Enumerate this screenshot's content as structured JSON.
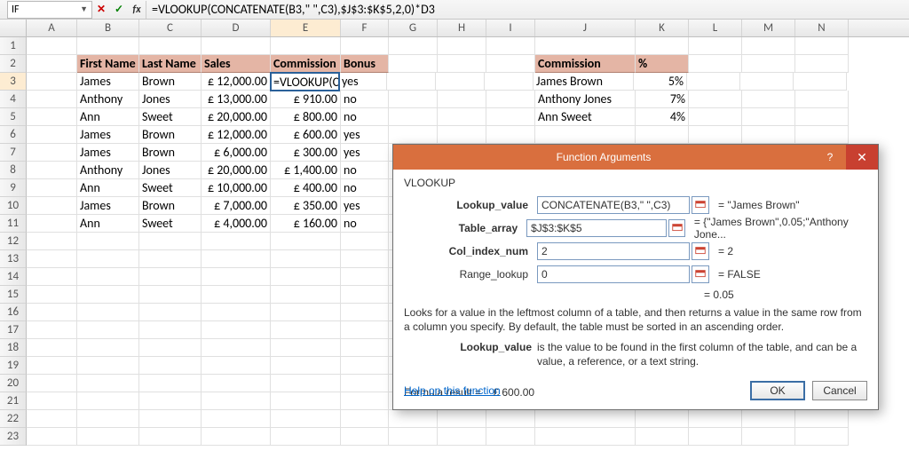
{
  "nameBox": "IF",
  "formula": "=VLOOKUP(CONCATENATE(B3,\" \",C3),$J$3:$K$5,2,0)*D3",
  "columns": [
    "A",
    "B",
    "C",
    "D",
    "E",
    "F",
    "G",
    "H",
    "I",
    "J",
    "K",
    "L",
    "M",
    "N"
  ],
  "activeCol": "E",
  "activeRow": 3,
  "editCell": "=VLOOKUP(CO",
  "headers": {
    "b": "First Name",
    "c": "Last Name",
    "d": "Sales",
    "e": "Commission",
    "f": "Bonus",
    "j": "Commission",
    "k": "%"
  },
  "table": [
    {
      "fn": "James",
      "ln": "Brown",
      "sales": "£ 12,000.00",
      "comm": "",
      "bonus": "yes"
    },
    {
      "fn": "Anthony",
      "ln": "Jones",
      "sales": "£ 13,000.00",
      "comm": "£      910.00",
      "bonus": "no"
    },
    {
      "fn": "Ann",
      "ln": "Sweet",
      "sales": "£ 20,000.00",
      "comm": "£      800.00",
      "bonus": "no"
    },
    {
      "fn": "James",
      "ln": "Brown",
      "sales": "£ 12,000.00",
      "comm": "£      600.00",
      "bonus": "yes"
    },
    {
      "fn": "James",
      "ln": "Brown",
      "sales": "£   6,000.00",
      "comm": "£      300.00",
      "bonus": "yes"
    },
    {
      "fn": "Anthony",
      "ln": "Jones",
      "sales": "£ 20,000.00",
      "comm": "£   1,400.00",
      "bonus": "no"
    },
    {
      "fn": "Ann",
      "ln": "Sweet",
      "sales": "£ 10,000.00",
      "comm": "£      400.00",
      "bonus": "no"
    },
    {
      "fn": "James",
      "ln": "Brown",
      "sales": "£   7,000.00",
      "comm": "£      350.00",
      "bonus": "yes"
    },
    {
      "fn": "Ann",
      "ln": "Sweet",
      "sales": "£   4,000.00",
      "comm": "£      160.00",
      "bonus": "no"
    }
  ],
  "lookup": [
    {
      "name": "James Brown",
      "pct": "5%"
    },
    {
      "name": "Anthony Jones",
      "pct": "7%"
    },
    {
      "name": "Ann Sweet",
      "pct": "4%"
    }
  ],
  "dialog": {
    "title": "Function Arguments",
    "fn": "VLOOKUP",
    "args": [
      {
        "label": "Lookup_value",
        "bold": true,
        "value": "CONCATENATE(B3,\" \",C3)",
        "result": "=   \"James Brown\""
      },
      {
        "label": "Table_array",
        "bold": true,
        "value": "$J$3:$K$5",
        "result": "=   {\"James Brown\",0.05;\"Anthony Jone..."
      },
      {
        "label": "Col_index_num",
        "bold": true,
        "value": "2",
        "result": "=   2"
      },
      {
        "label": "Range_lookup",
        "bold": false,
        "value": "0",
        "result": "=   FALSE"
      }
    ],
    "overallResult": "=   0.05",
    "desc": "Looks for a value in the leftmost column of a table, and then returns a value in the same row from a column you specify. By default, the table must be sorted in an ascending order.",
    "argHelpLabel": "Lookup_value",
    "argHelpText": "is the value to be found in the first column of the table, and can be a value, a reference, or a text string.",
    "formulaResultLabel": "Formula result =",
    "formulaResultValue": "£                      600.00",
    "helpLink": "Help on this function",
    "ok": "OK",
    "cancel": "Cancel"
  }
}
